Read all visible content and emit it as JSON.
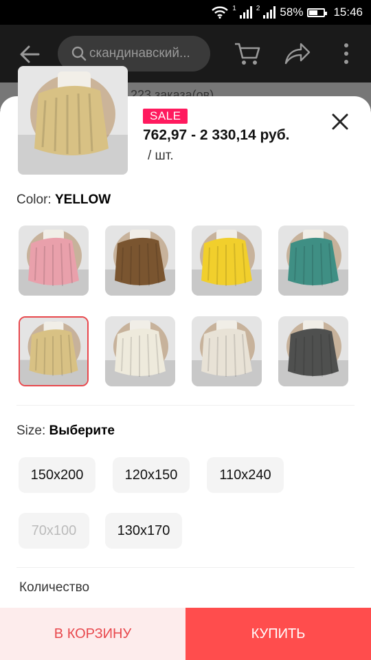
{
  "status_bar": {
    "battery": "58%",
    "time": "15:46",
    "sim1": "1",
    "sim2": "2",
    "battery_level": 0.58
  },
  "top_bar": {
    "search_text": "скандинавский..."
  },
  "behind": {
    "orders_text": "223 заказа(ов)"
  },
  "product": {
    "sale_badge": "SALE",
    "price": "762,97 - 2 330,14 руб.",
    "unit": "/ шт.",
    "thumb_color": "#d8c184"
  },
  "color_section": {
    "label": "Color:",
    "selected": "YELLOW",
    "swatches": [
      {
        "color": "#e9a0ab",
        "selected": false
      },
      {
        "color": "#7a5530",
        "selected": false
      },
      {
        "color": "#f1cf2c",
        "selected": false
      },
      {
        "color": "#3f8f84",
        "selected": false
      },
      {
        "color": "#d8c184",
        "selected": true
      },
      {
        "color": "#eeeadc",
        "selected": false
      },
      {
        "color": "#e8e2d6",
        "selected": false
      },
      {
        "color": "#4f504f",
        "selected": false
      }
    ]
  },
  "size_section": {
    "label": "Size:",
    "prompt": "Выберите",
    "options": [
      {
        "label": "150x200",
        "disabled": false
      },
      {
        "label": "120x150",
        "disabled": false
      },
      {
        "label": "110x240",
        "disabled": false
      },
      {
        "label": "70x100",
        "disabled": true
      },
      {
        "label": "130x170",
        "disabled": false
      }
    ]
  },
  "quantity": {
    "label": "Количество"
  },
  "actions": {
    "cart": "В КОРЗИНУ",
    "buy": "КУПИТЬ"
  },
  "colors": {
    "accent": "#ff4d4d",
    "sale": "#ff1a5e",
    "cart_bg": "#fdecec",
    "cart_text": "#e8474c"
  }
}
